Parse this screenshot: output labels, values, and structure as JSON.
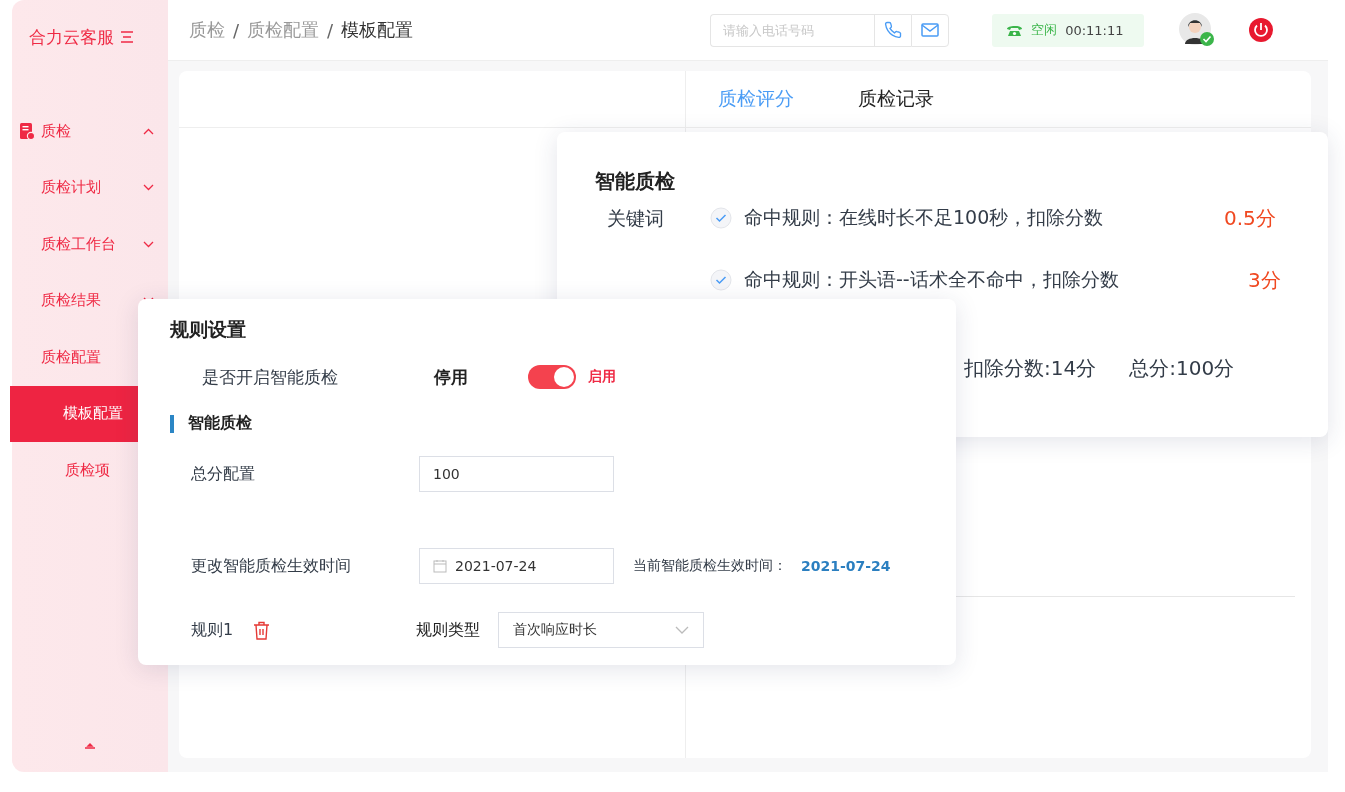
{
  "sidebar": {
    "brand": "合力云客服",
    "items": [
      {
        "label": "质检",
        "expanded": true,
        "children": [
          {
            "label": "质检计划",
            "expanded": false
          },
          {
            "label": "质检工作台",
            "expanded": false
          },
          {
            "label": "质检结果",
            "expanded": false
          },
          {
            "label": "质检配置",
            "children": [
              {
                "label": "模板配置",
                "selected": true
              },
              {
                "label": "质检项",
                "selected": false
              }
            ]
          }
        ]
      }
    ]
  },
  "header": {
    "breadcrumb": [
      "质检",
      "质检配置",
      "模板配置"
    ],
    "separator": "/",
    "phone_field": {
      "placeholder": "请输入电话号码"
    },
    "status": {
      "label": "空闲",
      "timer": "00:11:11"
    }
  },
  "tabs": [
    {
      "label": "质检评分",
      "selected": true
    },
    {
      "label": "质检记录",
      "selected": false
    }
  ],
  "score_card": {
    "title": "智能质检",
    "category": "关键词",
    "rules": [
      {
        "text": "命中规则：在线时长不足100秒，扣除分数",
        "checked": true,
        "deduction": "0.5分"
      },
      {
        "text": "命中规则：开头语--话术全不命中，扣除分数",
        "checked": true,
        "deduction": "3分"
      }
    ],
    "deducted": "扣除分数:14分",
    "total": "总分:100分"
  },
  "rule_settings": {
    "title": "规则设置",
    "switch_label": "是否开启智能质检",
    "off_label": "停用",
    "on_label": "启用",
    "on": true,
    "section": "智能质检",
    "total_score": {
      "label": "总分配置",
      "value": "100"
    },
    "effective": {
      "label": "更改智能质检生效时间",
      "value": "2021-07-24",
      "current_label": "当前智能质检生效时间：",
      "current_value": "2021-07-24"
    },
    "rule": {
      "name": "规则1",
      "type_label": "规则类型",
      "type_value": "首次响应时长"
    }
  }
}
